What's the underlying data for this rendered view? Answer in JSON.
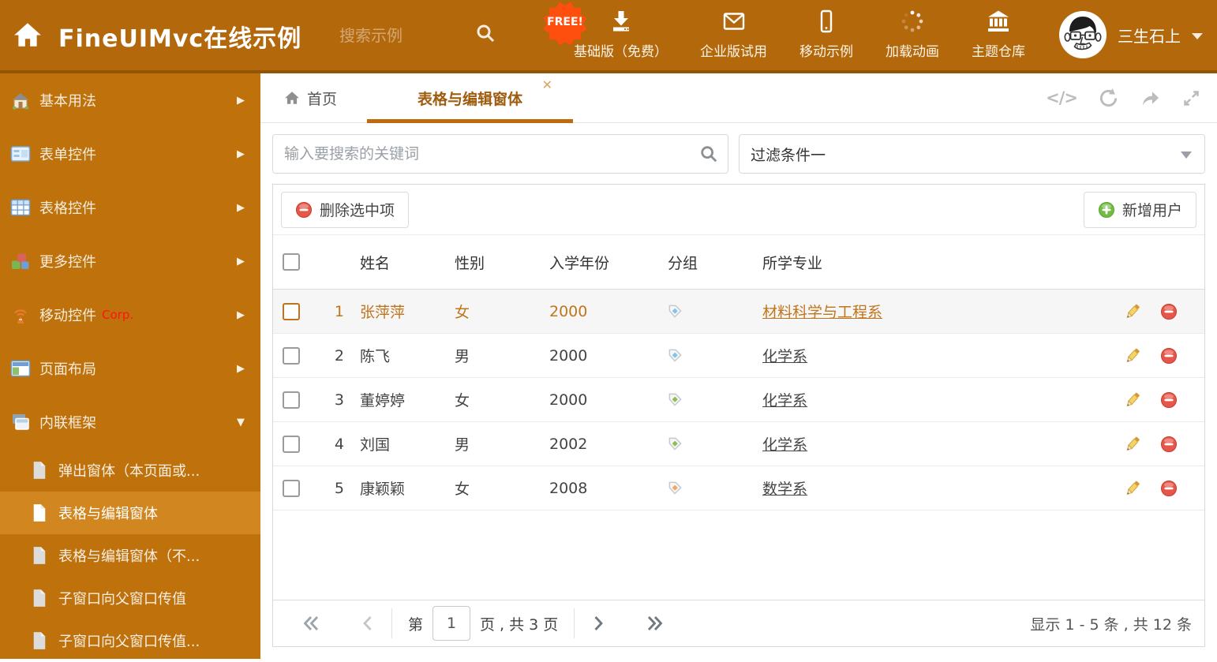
{
  "theme": {
    "header_bg": "#b3680c",
    "header_border": "#935403",
    "sidebar_bg": "#bf720c",
    "sidebar_selected_bg": "#d1861f",
    "accent_orange": "#bf6a0b",
    "selected_row_text": "#c0751c",
    "free_badge_bg": "#ff4f0e",
    "delete_red": "#e4574a",
    "add_green": "#72bb44",
    "tag_blue": "#85c4ee",
    "tag_green": "#8cc152",
    "tag_orange": "#f6a664"
  },
  "header": {
    "title": "FineUIMvc在线示例",
    "search_placeholder": "搜索示例",
    "free_badge": "FREE!",
    "nav": [
      {
        "label": "基础版（免费）"
      },
      {
        "label": "企业版试用"
      },
      {
        "label": "移动示例"
      },
      {
        "label": "加载动画"
      },
      {
        "label": "主题仓库"
      }
    ],
    "user_name": "三生石上"
  },
  "sidebar": {
    "items": [
      {
        "label": "基本用法"
      },
      {
        "label": "表单控件"
      },
      {
        "label": "表格控件"
      },
      {
        "label": "更多控件"
      },
      {
        "label": "移动控件",
        "badge": "Corp."
      },
      {
        "label": "页面布局"
      },
      {
        "label": "内联框架"
      }
    ],
    "subitems": [
      {
        "label": "弹出窗体（本页面或..."
      },
      {
        "label": "表格与编辑窗体"
      },
      {
        "label": "表格与编辑窗体（不..."
      },
      {
        "label": "子窗口向父窗口传值"
      },
      {
        "label": "子窗口向父窗口传值..."
      }
    ]
  },
  "tabs": {
    "home_label": "首页",
    "active_label": "表格与编辑窗体"
  },
  "corner": {
    "code_label": "</>"
  },
  "filter_bar": {
    "search_placeholder": "输入要搜索的关键词",
    "filter_value": "过滤条件一"
  },
  "toolbar": {
    "delete_label": "删除选中项",
    "add_label": "新增用户"
  },
  "table": {
    "columns": {
      "name": "姓名",
      "gender": "性别",
      "year": "入学年份",
      "group": "分组",
      "major": "所学专业"
    },
    "rows": [
      {
        "num": "1",
        "name": "张萍萍",
        "gender": "女",
        "year": "2000",
        "group_color": "blue",
        "major": "材料科学与工程系",
        "selected": true
      },
      {
        "num": "2",
        "name": "陈飞",
        "gender": "男",
        "year": "2000",
        "group_color": "blue",
        "major": "化学系"
      },
      {
        "num": "3",
        "name": "董婷婷",
        "gender": "女",
        "year": "2000",
        "group_color": "green",
        "major": "化学系"
      },
      {
        "num": "4",
        "name": "刘国",
        "gender": "男",
        "year": "2002",
        "group_color": "green",
        "major": "化学系"
      },
      {
        "num": "5",
        "name": "康颖颖",
        "gender": "女",
        "year": "2008",
        "group_color": "orange",
        "major": "数学系"
      }
    ]
  },
  "pagination": {
    "prefix": "第",
    "page_value": "1",
    "suffix": "页 , 共 3 页",
    "summary": "显示 1 - 5 条 , 共 12 条"
  }
}
